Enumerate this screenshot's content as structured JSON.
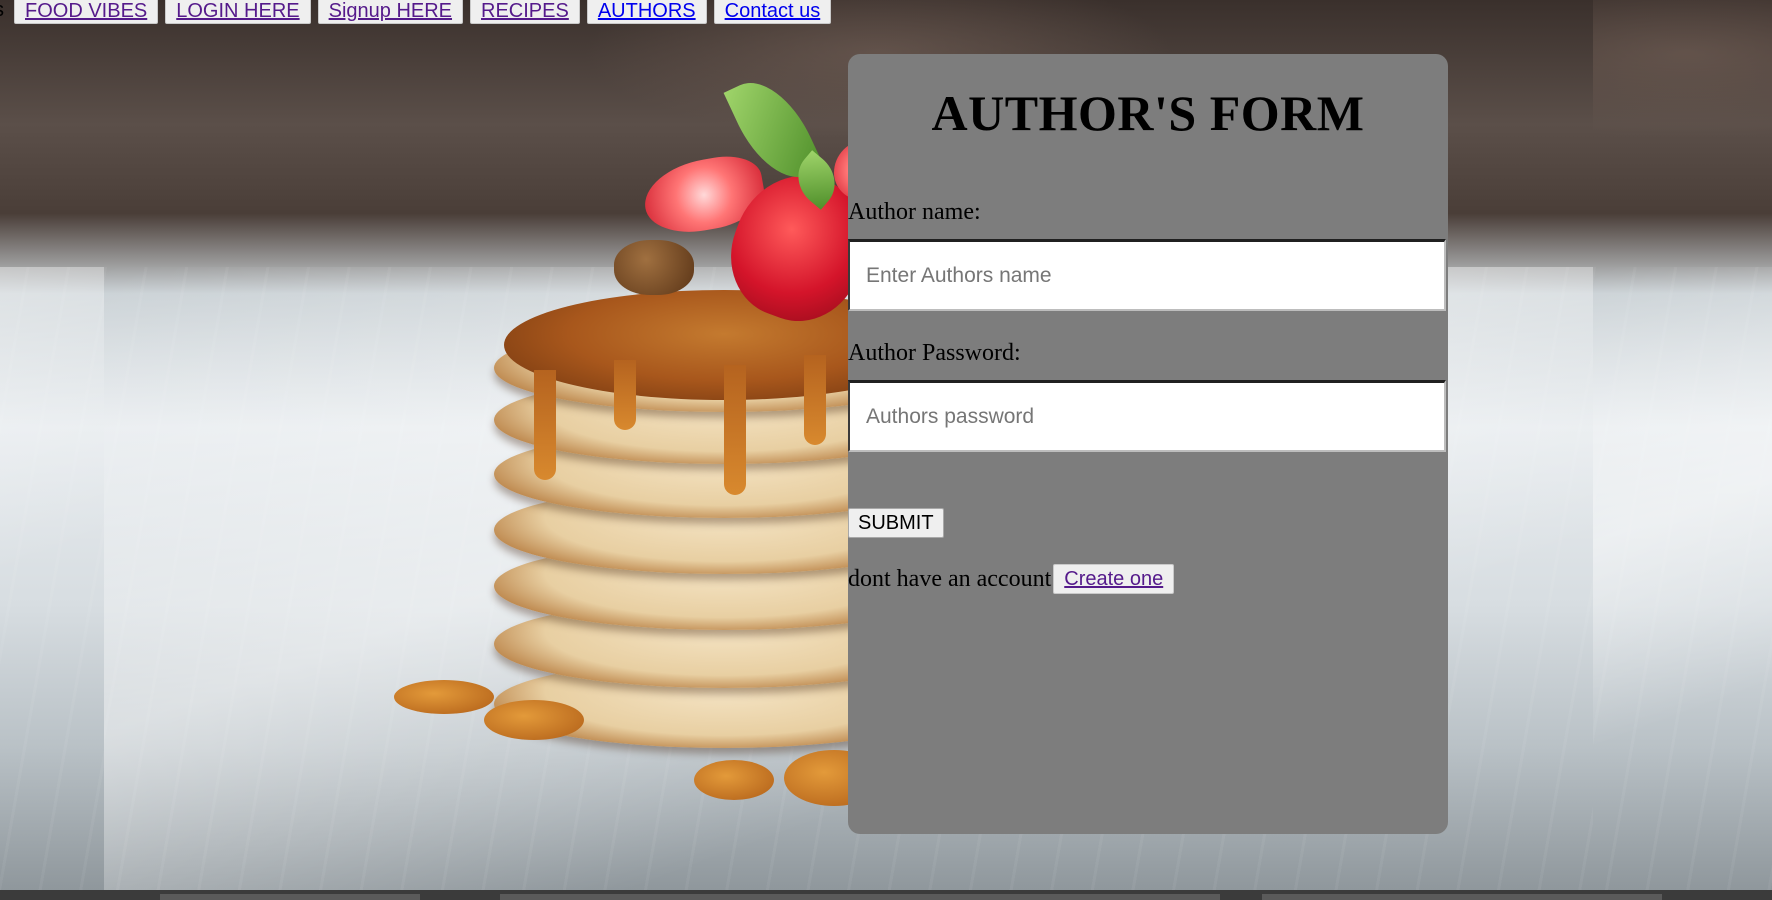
{
  "nav": {
    "cut_off_text": "s",
    "links": [
      {
        "label": "FOOD VIBES",
        "visited": true
      },
      {
        "label": "LOGIN HERE",
        "visited": true
      },
      {
        "label": "Signup HERE",
        "visited": true
      },
      {
        "label": "RECIPES",
        "visited": true
      },
      {
        "label": "AUTHORS",
        "visited": false
      },
      {
        "label": "Contact us",
        "visited": false
      }
    ]
  },
  "form": {
    "title": "AUTHOR'S FORM",
    "name_label": "Author name:",
    "name_placeholder": "Enter Authors name",
    "name_value": "",
    "password_label": "Author Password:",
    "password_placeholder": "Authors password",
    "password_value": "",
    "submit_label": "SUBMIT",
    "signup_prompt": "dont have an account",
    "create_link": "Create one"
  },
  "colors": {
    "card_bg": "#7d7d7d",
    "visited_link": "#551a8b",
    "unvisited_link": "#0000ee",
    "button_bg": "#efefef"
  },
  "background": {
    "subject": "pancake-stack-photo"
  }
}
